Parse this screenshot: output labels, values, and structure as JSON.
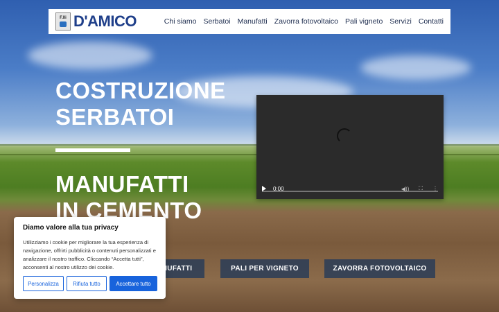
{
  "header": {
    "logo_small": "F.lli",
    "logo_text": "D'AMICO",
    "nav": [
      "Chi siamo",
      "Serbatoi",
      "Manufatti",
      "Zavorra fotovoltaico",
      "Pali vigneto",
      "Servizi",
      "Contatti"
    ]
  },
  "hero": {
    "line1": "COSTRUZIONE",
    "line2": "SERBATOI",
    "line3": "MANUFATTI",
    "line4": "IN CEMENTO"
  },
  "video": {
    "time": "0:00",
    "icons": [
      "play-icon",
      "mute-icon",
      "fullscreen-icon",
      "more-options-icon"
    ]
  },
  "cta": {
    "manufatti": "MANUFATTI",
    "pali": "PALI PER VIGNETO",
    "zavorra": "ZAVORRA FOTOVOLTAICO"
  },
  "cookie": {
    "title": "Diamo valore alla tua privacy",
    "text": "Utilizziamo i cookie per migliorare la tua esperienza di navigazione, offrirti pubblicità o contenuti personalizzati e analizzare il nostro traffico. Cliccando “Accetta tutti”, acconsenti al nostro utilizzo dei cookie.",
    "customize": "Personalizza",
    "reject": "Rifiuta tutto",
    "accept": "Accettare tutto"
  },
  "colors": {
    "brand_blue": "#1f3f8a",
    "cookie_accent": "#1863dc"
  }
}
